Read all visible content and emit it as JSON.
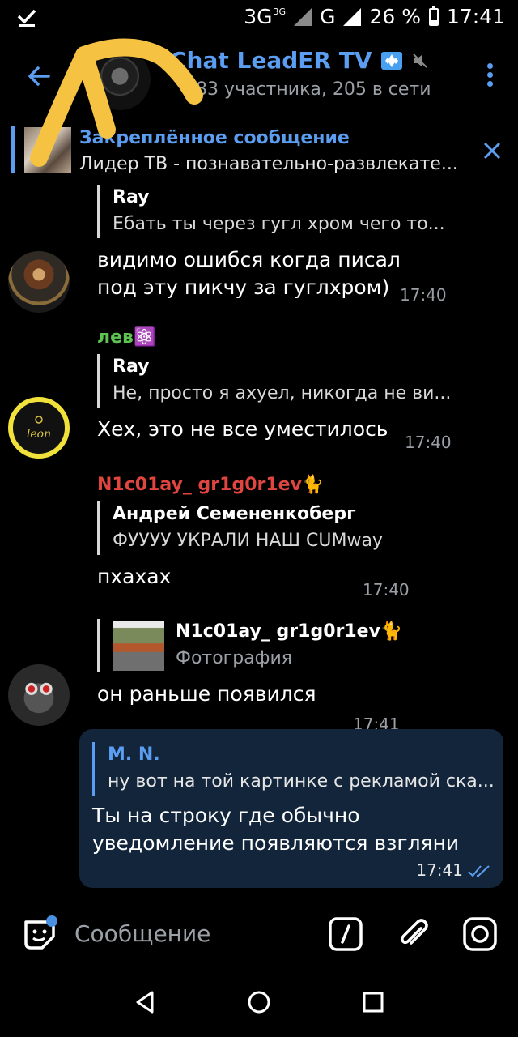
{
  "status_bar": {
    "network_1": "3G",
    "network_1_sup": "3G",
    "network_2": "G",
    "battery": "26 %",
    "time": "17:41",
    "battery_level": 0.26
  },
  "header": {
    "title": "Chat LeadER TV",
    "subtitle": "783 участника, 205 в сети",
    "icons": [
      "back-arrow-icon",
      "diamond-badge-icon",
      "muted-icon",
      "more-vert-icon"
    ]
  },
  "pinned": {
    "title": "Закреплённое сообщение",
    "text": "Лидер ТВ - познавательно-развлекате..."
  },
  "messages": [
    {
      "reply_name": "Ray",
      "reply_text": "Ебать ты через гугл хром чего то...",
      "text_line1": "видимо ошибся когда писал",
      "text_line2": "под эту пикчу за гуглхром)",
      "time": "17:40"
    },
    {
      "sender": "лев⚛️",
      "sender_color": "#5dc452",
      "reply_name": "Ray",
      "reply_text": "Не, просто я ахуел, никогда не ви...",
      "text": "Хех, это не все уместилось",
      "time": "17:40"
    },
    {
      "sender": "N1c01ay_ gr1g0r1ev🐈",
      "sender_color": "#e0453f",
      "reply_name": "Андрей Семененкоберг",
      "reply_text": "ФУУУУ УКРАЛИ НАШ CUMway",
      "text": "пхахах",
      "time": "17:40"
    },
    {
      "reply_name": "N1c01ay_ gr1g0r1ev🐈",
      "reply_text": "Фотография",
      "text": "он раньше появился",
      "time": "17:41"
    }
  ],
  "outgoing": {
    "reply_name": "M. N.",
    "reply_text": "ну вот на той картинке с рекламой ска...",
    "text_line1": "Ты на строку где обычно",
    "text_line2": "уведомление появляются взгляни",
    "time": "17:41"
  },
  "input": {
    "placeholder": "Сообщение"
  },
  "colors": {
    "accent": "#5b9df0",
    "background": "#000000",
    "bubble_out": "#12253b",
    "annotation": "#f5c242"
  }
}
